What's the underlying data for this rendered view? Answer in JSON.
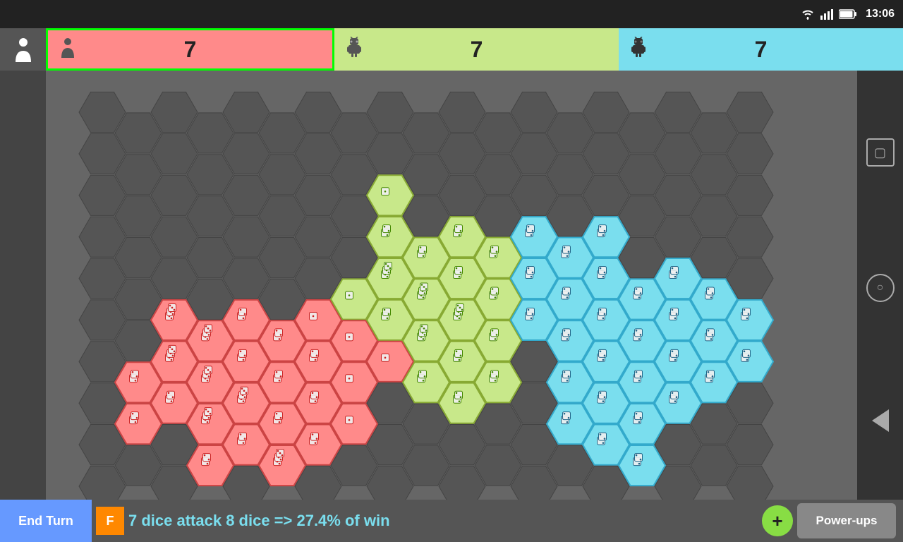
{
  "statusBar": {
    "time": "13:06",
    "icons": [
      "wifi",
      "signal",
      "battery"
    ]
  },
  "players": [
    {
      "id": 1,
      "icon": "person",
      "score": "7",
      "color": "#ff8a8a",
      "borderColor": "#00ff00",
      "type": "human"
    },
    {
      "id": 2,
      "icon": "android",
      "score": "7",
      "color": "#c8e88a",
      "type": "ai"
    },
    {
      "id": 3,
      "icon": "android",
      "score": "7",
      "color": "#7adeee",
      "type": "ai"
    }
  ],
  "bottomBar": {
    "endTurnLabel": "End Turn",
    "flashLabel": "F",
    "message": "7 dice attack 8 dice => 27.4% of win",
    "plusLabel": "+",
    "powerUpsLabel": "Power-ups"
  },
  "androidButtons": {
    "square": "▢",
    "circle": "○",
    "back": "◁"
  }
}
